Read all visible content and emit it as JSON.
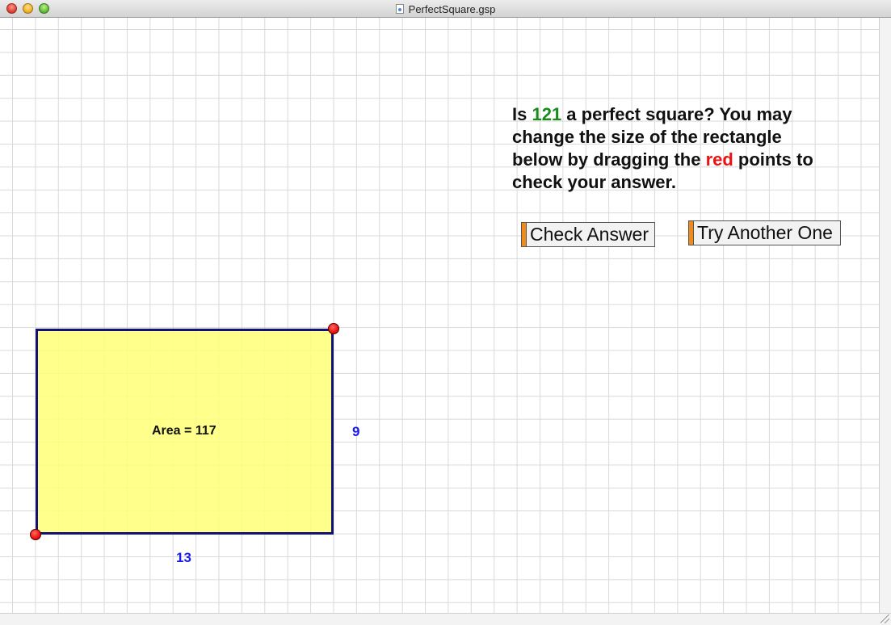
{
  "window": {
    "title": "PerfectSquare.gsp"
  },
  "question": {
    "part1": "Is ",
    "number": "121",
    "part2": " a perfect square? You may change the size of the rectangle below by dragging the ",
    "red_word": "red",
    "part3": " points to check your answer.",
    "number_color": "#1a8a1a",
    "red_color": "#ee1111"
  },
  "buttons": {
    "check_label": "Check Answer",
    "try_label": "Try Another One",
    "accent_color": "#f08a1a"
  },
  "rectangle": {
    "area_label": "Area = 117",
    "height_label": "9",
    "width_label": "13",
    "fill_color": "#ffff78",
    "border_color": "#111177"
  },
  "handles": {
    "color": "#ee1111"
  }
}
